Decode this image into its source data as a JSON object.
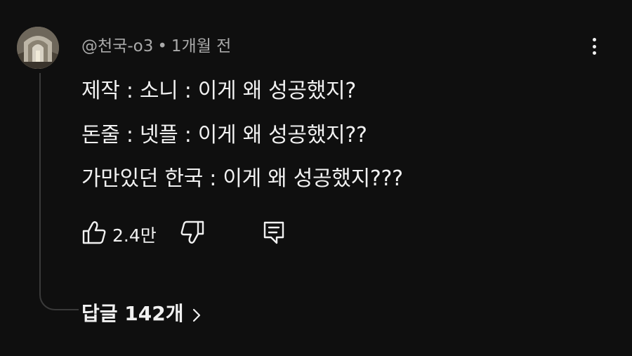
{
  "comment": {
    "author": "@천국-o3",
    "separator": "•",
    "time": "1개월 전",
    "lines": [
      "제작 : 소니 : 이게 왜 성공했지?",
      "돈줄 : 넷플 : 이게 왜 성공했지??",
      "가만있던 한국 : 이게 왜 성공했지???"
    ],
    "likes": "2.4만",
    "replies_label": "답글 142개"
  },
  "icons": {
    "avatar": "avatar-cathedral-icon",
    "menu": "more-vertical-icon",
    "like": "thumbs-up-icon",
    "dislike": "thumbs-down-icon",
    "reply": "comment-icon",
    "chevron": "chevron-right-icon"
  },
  "colors": {
    "background": "#0f0f0f",
    "text": "#f1f1f1",
    "secondary_text": "#aaaaaa",
    "thread_line": "#3a3a3a"
  }
}
